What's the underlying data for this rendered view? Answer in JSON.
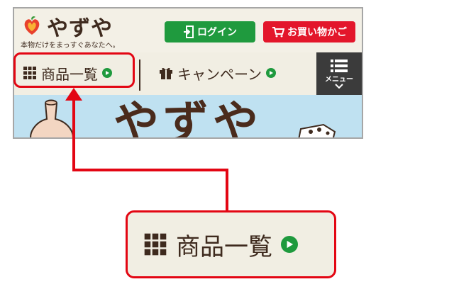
{
  "header": {
    "logo_text": "やずや",
    "tagline": "本物だけをまっすぐあなたへ。",
    "login_label": "ログイン",
    "cart_label": "お買い物かご"
  },
  "nav": {
    "products_label": "商品一覧",
    "campaign_label": "キャンペーン",
    "menu_label": "メニュー"
  },
  "banner": {
    "logo_text": "やずや"
  },
  "zoom": {
    "label": "商品一覧"
  },
  "colors": {
    "brand_brown": "#3e2a1e",
    "login_green": "#1f9a3e",
    "cart_red": "#e3162b",
    "callout_red": "#e30613",
    "play_green": "#1f9a3e"
  }
}
